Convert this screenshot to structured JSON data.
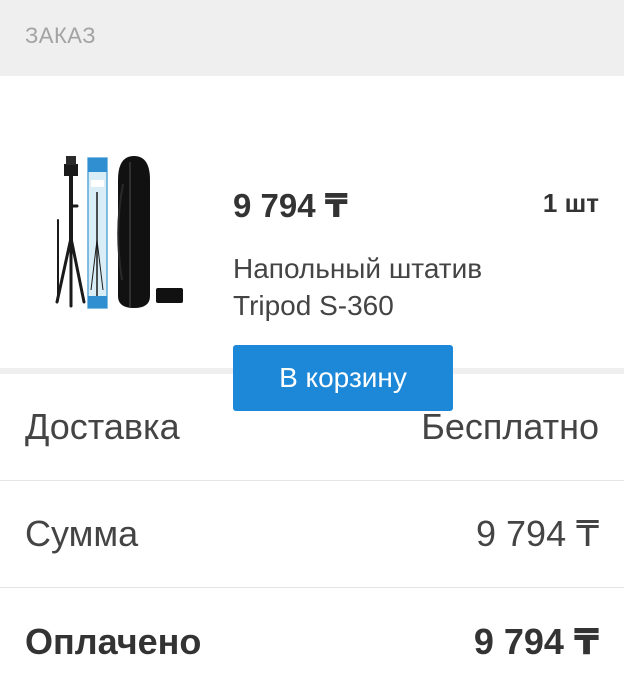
{
  "section": {
    "title": "ЗАКАЗ"
  },
  "item": {
    "price": "9 794 ₸",
    "quantity": "1 шт",
    "name": "Напольный штатив Tripod S-360",
    "add_to_cart_label": "В корзину",
    "image_description": "tripod with box and carry bag"
  },
  "summary": {
    "rows": [
      {
        "label": "Доставка",
        "value": "Бесплатно"
      },
      {
        "label": "Сумма",
        "value": "9 794 ₸"
      },
      {
        "label": "Оплачено",
        "value": "9 794 ₸"
      }
    ]
  },
  "colors": {
    "accent": "#1e88d8",
    "header_bg": "#efefef",
    "header_text": "#a3a3a3"
  }
}
